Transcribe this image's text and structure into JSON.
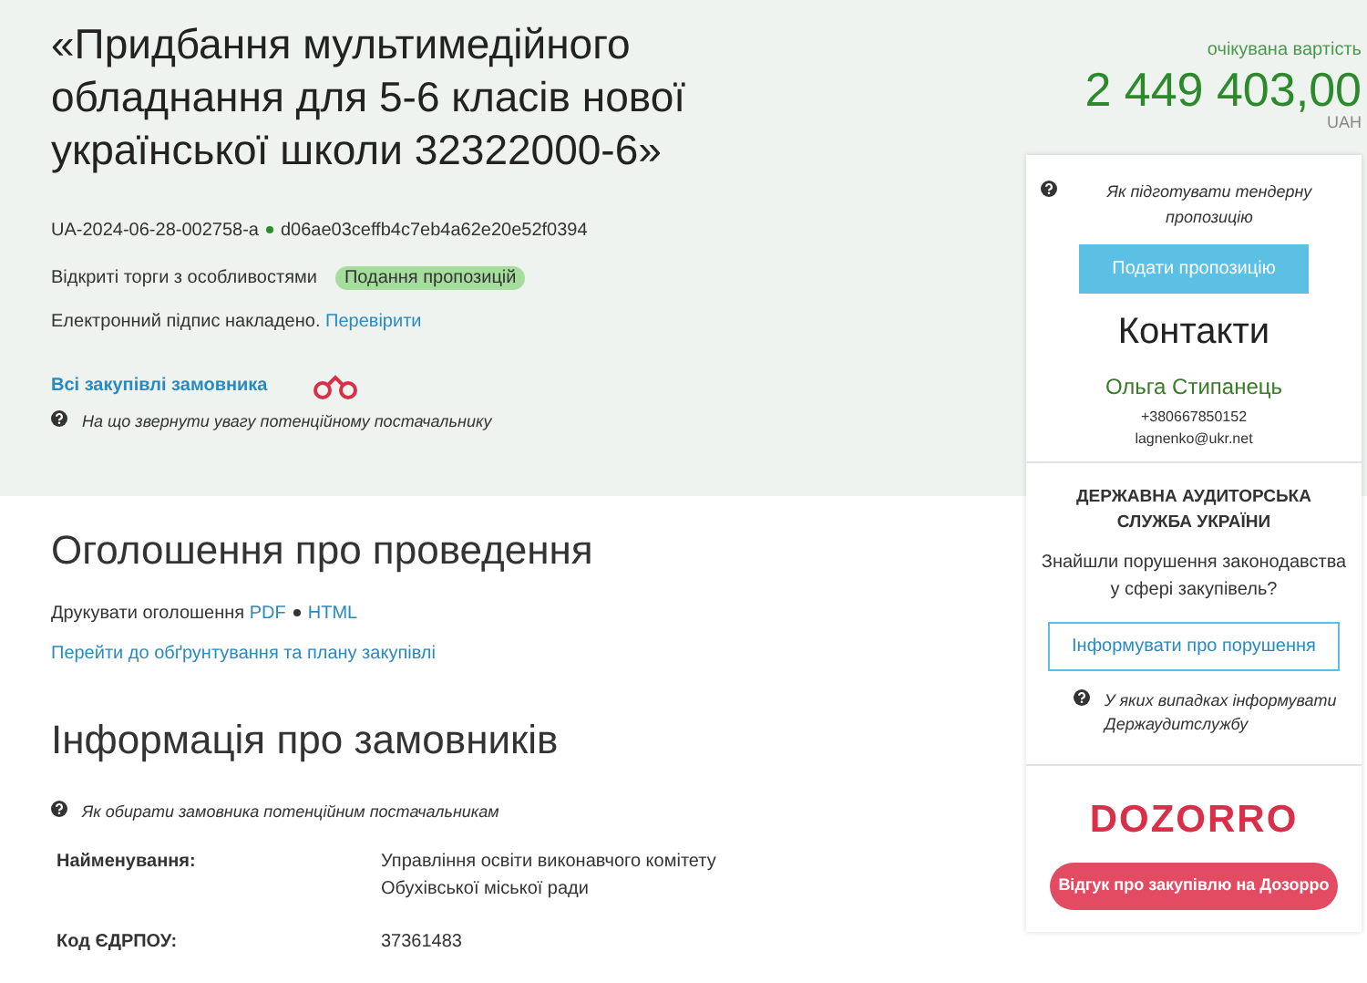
{
  "tender": {
    "title": "«Придбання мультимедійного обладнання для 5-6 класів нової української школи 32322000-6»",
    "id": "UA-2024-06-28-002758-a",
    "hash": "d06ae03ceffb4c7eb4a62e20e52f0394",
    "procedure": "Відкриті торги з особливостями",
    "status": "Подання пропозицій",
    "signature_text": "Електронний підпис накладено.",
    "signature_link": "Перевірити",
    "all_purchases_link": "Всі закупівлі замовника",
    "hint": "На що звернути увагу потенційному постачальнику"
  },
  "value": {
    "label": "очікувана вартість",
    "amount": "2 449 403,00",
    "currency": "UAH"
  },
  "sidebar": {
    "hint": "Як підготувати тендерну пропозицію",
    "submit_button": "Подати пропозицію",
    "contacts_title": "Контакти",
    "contact_name": "Ольга Стипанець",
    "phone": "+380667850152",
    "email": "lagnenko@ukr.net",
    "audit_title": "ДЕРЖАВНА АУДИТОРСЬКА СЛУЖБА УКРАЇНИ",
    "audit_question": "Знайшли порушення законодавства у сфері закупівель?",
    "report_button": "Інформувати про порушення",
    "audit_hint": "У яких випадках інформувати Держаудитслужбу",
    "logo": "DOZORRO",
    "review_button": "Відгук про закупівлю на Дозорро"
  },
  "announcement": {
    "heading": "Оголошення про проведення",
    "print_label": "Друкувати оголошення",
    "print_links": [
      "PDF",
      "HTML"
    ],
    "plan_link": "Перейти до обґрунтування та плану закупівлі"
  },
  "customer": {
    "heading": "Інформація про замовників",
    "hint": "Як обирати замовника потенційним постачальникам",
    "fields": [
      {
        "label": "Найменування:",
        "value": "Управління освіти виконавчого комітету Обухівської міської ради"
      },
      {
        "label": "Код ЄДРПОУ:",
        "value": "37361483"
      }
    ]
  }
}
